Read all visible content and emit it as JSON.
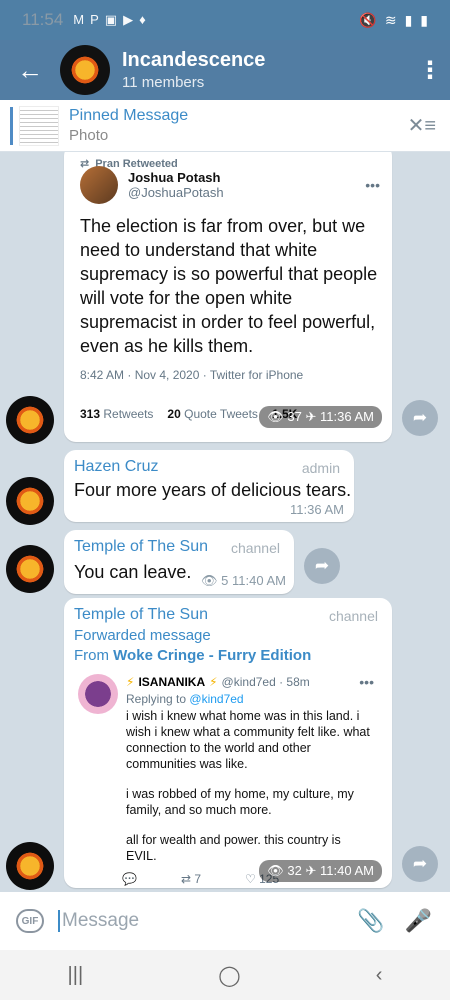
{
  "status_bar": {
    "time": "11:54"
  },
  "header": {
    "title": "Incandescence",
    "subtitle": "11 members"
  },
  "pinned": {
    "title": "Pinned Message",
    "subtitle": "Photo"
  },
  "messages": {
    "tweet1": {
      "retweet_label": "Pran Retweeted",
      "author": "Joshua Potash",
      "handle": "@JoshuaPotash",
      "body": "The election is far from over, but we need to understand that white supremacy is so powerful that people will vote for the open white supremacist in order to feel powerful, even as he kills them.",
      "meta": "8:42 AM · Nov 4, 2020 · Twitter for iPhone",
      "retweets_count": "313",
      "retweets_label": "Retweets",
      "quote_count": "20",
      "quote_label": "Quote Tweets",
      "likes_count": "1.5K",
      "views": "37",
      "time": "11:36 AM"
    },
    "msg2": {
      "sender": "Hazen Cruz",
      "role": "admin",
      "text": "Four more years of delicious tears.",
      "time": "11:36 AM"
    },
    "msg3": {
      "sender": "Temple of The Sun",
      "role": "channel",
      "text": "You can leave.",
      "views": "5",
      "time": "11:40 AM"
    },
    "msg4": {
      "sender": "Temple of The Sun",
      "role": "channel",
      "forwarded": "Forwarded message",
      "from_prefix": "From",
      "from_source": "Woke Cringe - Furry Edition",
      "tweet_name": "ISANANIKA",
      "tweet_handle": "@kind7ed · 58m",
      "reply_to_prefix": "Replying to",
      "reply_to": "@kind7ed",
      "para1": "i wish i knew what home was in this land. i wish i knew what a community felt like. what connection to the world and other communities was like.",
      "para2": "i was robbed of my home, my culture, my family, and so much more.",
      "para3": "all for wealth and power. this country is EVIL.",
      "rt_count": "7",
      "like_count": "125",
      "views": "32",
      "time": "11:40 AM"
    }
  },
  "composer": {
    "placeholder": "Message",
    "gif_label": "GIF"
  }
}
